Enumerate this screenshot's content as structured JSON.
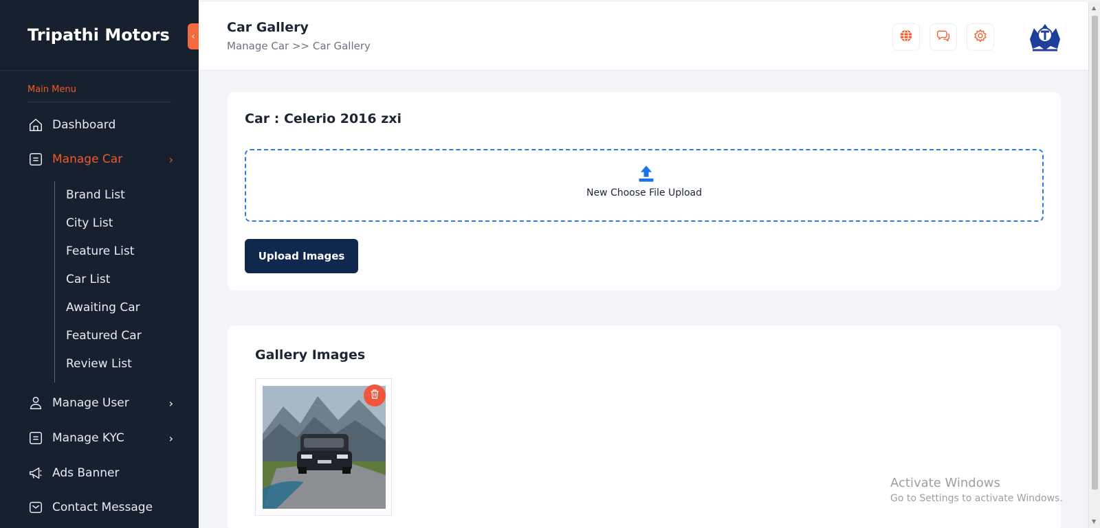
{
  "sidebar": {
    "brand": "Tripathi Motors",
    "menu_caption": "Main Menu",
    "items": [
      {
        "label": "Dashboard",
        "icon": "home-icon"
      },
      {
        "label": "Manage Car",
        "icon": "list-icon",
        "active": true
      },
      {
        "label": "Manage User",
        "icon": "user-icon"
      },
      {
        "label": "Manage KYC",
        "icon": "list-icon"
      },
      {
        "label": "Ads Banner",
        "icon": "megaphone-icon"
      },
      {
        "label": "Contact Message",
        "icon": "mail-icon"
      }
    ],
    "submenu": [
      "Brand List",
      "City List",
      "Feature List",
      "Car List",
      "Awaiting Car",
      "Featured Car",
      "Review List"
    ]
  },
  "header": {
    "title": "Car Gallery",
    "breadcrumb": "Manage Car >> Car Gallery",
    "actions": [
      "globe-icon",
      "chat-icon",
      "settings-icon"
    ]
  },
  "upload": {
    "car_title": "Car : Celerio 2016 zxi",
    "dropzone_text": "New Choose File Upload",
    "button_label": "Upload Images"
  },
  "gallery": {
    "title": "Gallery Images",
    "images": [
      {
        "alt": "car-photo"
      }
    ]
  },
  "watermark": {
    "title": "Activate Windows",
    "subtitle": "Go to Settings to activate Windows."
  },
  "colors": {
    "sidebar_bg": "#17202e",
    "accent": "#f05a28",
    "button_bg": "#10284c",
    "dropzone_border": "#2a7be4"
  }
}
